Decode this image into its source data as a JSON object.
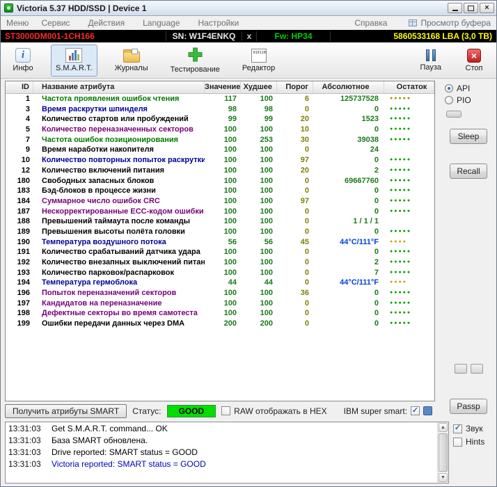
{
  "theme": {
    "value_color": "#1a7a1a",
    "threshold_color": "#7e7e00",
    "status_good_bg": "#00df00",
    "selected_tool_bg": "#dce9f6",
    "model_color": "#ff2a2a",
    "firmware_color": "#00d000",
    "capacity_color": "#ffff00"
  },
  "window": {
    "title": "Victoria 5.37 HDD/SSD | Device 1"
  },
  "menubar": {
    "items": [
      "Меню",
      "Сервис",
      "Действия",
      "Language",
      "Настройки",
      "Справка"
    ],
    "buffer_view": "Просмотр буфера"
  },
  "device_bar": {
    "model": "ST3000DM001-1CH166",
    "serial": "SN: W1F4ENKQ",
    "separator": "x",
    "firmware": "Fw: HP34",
    "capacity": "5860533168 LBA (3,0 ТВ)"
  },
  "toolbar": {
    "info": "Инфо",
    "smart": "S.M.A.R.T.",
    "logs": "Журналы",
    "test": "Тестирование",
    "editor": "Редактор",
    "pause": "Пауза",
    "stop": "Стоп"
  },
  "icons": {
    "info_glyph": "i",
    "stop_glyph": "×"
  },
  "side_panel": {
    "api": "API",
    "pio": "PIO",
    "sleep": "Sleep",
    "recall": "Recall",
    "passp": "Passp"
  },
  "table": {
    "headers": [
      "ID",
      "Название атрибута",
      "Значение",
      "Худшее",
      "Порог",
      "Абсолютное",
      "Остаток"
    ],
    "rows": [
      {
        "id": "1",
        "name": "Частота проявления ошибок чтения",
        "name_color": "#007800",
        "value": "117",
        "worst": "100",
        "threshold": "6",
        "absolute": "125737528",
        "dots": 5,
        "dots_color": "#999900"
      },
      {
        "id": "3",
        "name": "Время раскрутки шпинделя",
        "name_color": "#000099",
        "value": "98",
        "worst": "98",
        "threshold": "0",
        "absolute": "0",
        "dots": 5,
        "dots_color": "#00a000"
      },
      {
        "id": "4",
        "name": "Количество стартов или пробуждений",
        "name_color": "#000000",
        "value": "99",
        "worst": "99",
        "threshold": "20",
        "absolute": "1523",
        "dots": 5,
        "dots_color": "#00a000"
      },
      {
        "id": "5",
        "name": "Количество переназначенных секторов",
        "name_color": "#770077",
        "value": "100",
        "worst": "100",
        "threshold": "10",
        "absolute": "0",
        "dots": 5,
        "dots_color": "#00a000"
      },
      {
        "id": "7",
        "name": "Частота ошибок позиционирования",
        "name_color": "#007800",
        "value": "100",
        "worst": "253",
        "threshold": "30",
        "absolute": "39038",
        "dots": 5,
        "dots_color": "#00a000"
      },
      {
        "id": "9",
        "name": "Время наработки накопителя",
        "name_color": "#000000",
        "value": "100",
        "worst": "100",
        "threshold": "0",
        "absolute": "24",
        "dots": 0
      },
      {
        "id": "10",
        "name": "Количество повторных попыток раскрутки",
        "name_color": "#000099",
        "value": "100",
        "worst": "100",
        "threshold": "97",
        "absolute": "0",
        "dots": 5,
        "dots_color": "#00a000"
      },
      {
        "id": "12",
        "name": "Количество включений питания",
        "name_color": "#000000",
        "value": "100",
        "worst": "100",
        "threshold": "20",
        "absolute": "2",
        "dots": 5,
        "dots_color": "#00a000"
      },
      {
        "id": "180",
        "name": "Свободных запасных блоков",
        "name_color": "#000000",
        "value": "100",
        "worst": "100",
        "threshold": "0",
        "absolute": "69667760",
        "dots": 5,
        "dots_color": "#00a000"
      },
      {
        "id": "183",
        "name": "Бэд-блоков в процессе жизни",
        "name_color": "#000000",
        "value": "100",
        "worst": "100",
        "threshold": "0",
        "absolute": "0",
        "dots": 5,
        "dots_color": "#00a000"
      },
      {
        "id": "184",
        "name": "Суммарное число ошибок CRC",
        "name_color": "#770077",
        "value": "100",
        "worst": "100",
        "threshold": "97",
        "absolute": "0",
        "dots": 5,
        "dots_color": "#00a000"
      },
      {
        "id": "187",
        "name": "Нескорректированные ECC-кодом ошибки",
        "name_color": "#770077",
        "value": "100",
        "worst": "100",
        "threshold": "0",
        "absolute": "0",
        "dots": 5,
        "dots_color": "#00a000"
      },
      {
        "id": "188",
        "name": "Превышений таймаута после команды",
        "name_color": "#000000",
        "value": "100",
        "worst": "100",
        "threshold": "0",
        "absolute": "1 / 1 / 1",
        "dots": 0
      },
      {
        "id": "189",
        "name": "Превышения высоты полёта головки",
        "name_color": "#000000",
        "value": "100",
        "worst": "100",
        "threshold": "0",
        "absolute": "0",
        "dots": 5,
        "dots_color": "#00a000"
      },
      {
        "id": "190",
        "name": "Температура воздушного потока",
        "name_color": "#000099",
        "value": "56",
        "worst": "56",
        "threshold": "45",
        "absolute": "44°C/111°F",
        "absolute_color": "#0040dd",
        "dots": 4,
        "dots_color": "#cca400"
      },
      {
        "id": "191",
        "name": "Количество срабатываний датчика удара",
        "name_color": "#000000",
        "value": "100",
        "worst": "100",
        "threshold": "0",
        "absolute": "0",
        "dots": 5,
        "dots_color": "#00a000"
      },
      {
        "id": "192",
        "name": "Количество внезапных выключений питания",
        "name_color": "#000000",
        "value": "100",
        "worst": "100",
        "threshold": "0",
        "absolute": "2",
        "dots": 5,
        "dots_color": "#00a000"
      },
      {
        "id": "193",
        "name": "Количество парковок/распарковок",
        "name_color": "#000000",
        "value": "100",
        "worst": "100",
        "threshold": "0",
        "absolute": "7",
        "dots": 5,
        "dots_color": "#00a000"
      },
      {
        "id": "194",
        "name": "Температура гермоблока",
        "name_color": "#000099",
        "value": "44",
        "worst": "44",
        "threshold": "0",
        "absolute": "44°C/111°F",
        "absolute_color": "#0040dd",
        "dots": 4,
        "dots_color": "#cca400"
      },
      {
        "id": "196",
        "name": "Попыток переназначений секторов",
        "name_color": "#770077",
        "value": "100",
        "worst": "100",
        "threshold": "36",
        "absolute": "0",
        "dots": 5,
        "dots_color": "#00a000"
      },
      {
        "id": "197",
        "name": "Кандидатов на переназначение",
        "name_color": "#770077",
        "value": "100",
        "worst": "100",
        "threshold": "0",
        "absolute": "0",
        "dots": 5,
        "dots_color": "#00a000"
      },
      {
        "id": "198",
        "name": "Дефектные секторы во время самотеста",
        "name_color": "#770077",
        "value": "100",
        "worst": "100",
        "threshold": "0",
        "absolute": "0",
        "dots": 5,
        "dots_color": "#00a000"
      },
      {
        "id": "199",
        "name": "Ошибки передачи данных через DMA",
        "name_color": "#000000",
        "value": "200",
        "worst": "200",
        "threshold": "0",
        "absolute": "0",
        "dots": 5,
        "dots_color": "#00a000"
      }
    ]
  },
  "status_bar": {
    "get_smart_button": "Получить атрибуты SMART",
    "status_label": "Статус:",
    "status_value": "GOOD",
    "raw_hex_label": "RAW отображать в HEX",
    "ibm_label": "IBM super smart:"
  },
  "log": {
    "lines": [
      {
        "time": "13:31:03",
        "text": "Get S.M.A.R.T. command... OK",
        "color": "#000000"
      },
      {
        "time": "13:31:03",
        "text": "База SMART обновлена.",
        "color": "#000000"
      },
      {
        "time": "13:31:03",
        "text": "Drive reported: SMART status = GOOD",
        "color": "#000000"
      },
      {
        "time": "13:31:03",
        "text": "Victoria reported: SMART status = GOOD",
        "color": "#0000bb"
      }
    ]
  },
  "log_side": {
    "sound": "Звук",
    "hints": "Hints"
  }
}
